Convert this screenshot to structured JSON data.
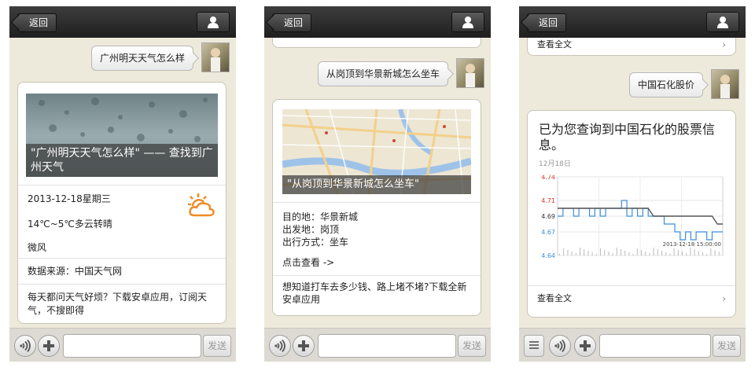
{
  "common": {
    "back_label": "返回",
    "send_label": "发送"
  },
  "screen1": {
    "query": "广州明天天气怎么样",
    "image_caption": "\"广州明天天气怎么样\" —— 查找到广州天气",
    "date": "2013-12-18星期三",
    "temperature": "14℃~5℃多云转晴",
    "wind": "微风",
    "source": "数据来源：中国天气网",
    "promo": "每天都问天气好烦？下载安卓应用，订阅天气，不搜即得"
  },
  "screen2": {
    "query": "从岗顶到华景新城怎么坐车",
    "map_caption": "\"从岗顶到华景新城怎么坐车\"",
    "destination": "目的地：华景新城",
    "origin": "出发地：岗顶",
    "mode": "出行方式：坐车",
    "view_link": "点击查看 ->",
    "promo": "想知道打车去多少钱、路上堵不堵?下载全新安卓应用"
  },
  "screen3": {
    "top_link": "查看全文",
    "query": "中国石化股价",
    "title": "已为您查询到中国石化的股票信息。",
    "chart_date": "12月18日",
    "chart_timestamp": "2013-12-18 15:00:00",
    "bottom_link": "查看全文"
  },
  "chart_data": {
    "type": "line",
    "ylim": [
      4.64,
      4.74
    ],
    "y_ticks": [
      "4.74",
      "4.71",
      "4.69",
      "4.67",
      "4.64"
    ],
    "series": [
      {
        "values": [
          4.69,
          4.7,
          4.7,
          4.69,
          4.7,
          4.7,
          4.69,
          4.7,
          4.69,
          4.7,
          4.7,
          4.7,
          4.71,
          4.69,
          4.7,
          4.69,
          4.7,
          4.69,
          4.69,
          4.69,
          4.68,
          4.68,
          4.67,
          4.66,
          4.67,
          4.66,
          4.67,
          4.67,
          4.66,
          4.67,
          4.67,
          4.67
        ]
      },
      {
        "values": [
          4.7,
          4.7,
          4.7,
          4.7,
          4.7,
          4.7,
          4.7,
          4.7,
          4.7,
          4.7,
          4.7,
          4.7,
          4.7,
          4.7,
          4.7,
          4.7,
          4.7,
          4.7,
          4.69,
          4.69,
          4.69,
          4.69,
          4.69,
          4.69,
          4.69,
          4.69,
          4.69,
          4.69,
          4.69,
          4.69,
          4.68,
          4.68
        ]
      }
    ]
  },
  "colors": {
    "topbar": "#2b2b2b",
    "background": "#eeeadb",
    "line_price": "#3a8fd6",
    "line_avg": "#555555",
    "tick_red": "#e0302c"
  }
}
